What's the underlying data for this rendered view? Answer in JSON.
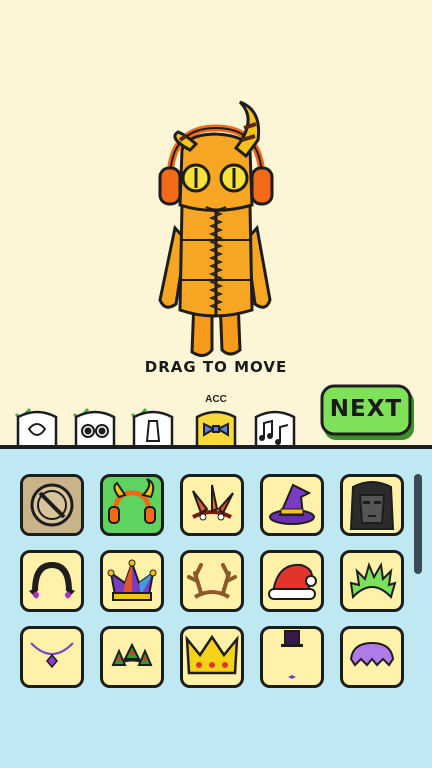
{
  "hint": {
    "drag": "DRAG TO MOVE"
  },
  "tabs": [
    {
      "name": "head",
      "checked": true,
      "label": ""
    },
    {
      "name": "eyes",
      "checked": true,
      "label": ""
    },
    {
      "name": "mouth",
      "checked": true,
      "label": ""
    },
    {
      "name": "accessories",
      "checked": false,
      "label": "ACC",
      "active": true
    },
    {
      "name": "music",
      "checked": false,
      "label": ""
    }
  ],
  "next_button": {
    "label": "NEXT"
  },
  "colors": {
    "panel": "#bfe9f2",
    "item": "#fff1a8",
    "selected": "#5fd35f",
    "next": "#7fe05a",
    "character": "#f7a624"
  },
  "items": [
    {
      "icon": "none-icon",
      "selected": false
    },
    {
      "icon": "headphones-horns-icon",
      "selected": true
    },
    {
      "icon": "feather-headband-icon",
      "selected": false
    },
    {
      "icon": "witch-hat-icon",
      "selected": false
    },
    {
      "icon": "squid-mask-icon",
      "selected": false
    },
    {
      "icon": "black-bow-headband-icon",
      "selected": false
    },
    {
      "icon": "jester-hat-icon",
      "selected": false
    },
    {
      "icon": "antlers-headband-icon",
      "selected": false
    },
    {
      "icon": "santa-hat-icon",
      "selected": false
    },
    {
      "icon": "green-spiky-hair-icon",
      "selected": false
    },
    {
      "icon": "purple-necklace-icon",
      "selected": false
    },
    {
      "icon": "holly-headband-icon",
      "selected": false
    },
    {
      "icon": "crown-icon",
      "selected": false
    },
    {
      "icon": "top-hat-icon",
      "selected": false
    },
    {
      "icon": "purple-wig-icon",
      "selected": false
    }
  ]
}
